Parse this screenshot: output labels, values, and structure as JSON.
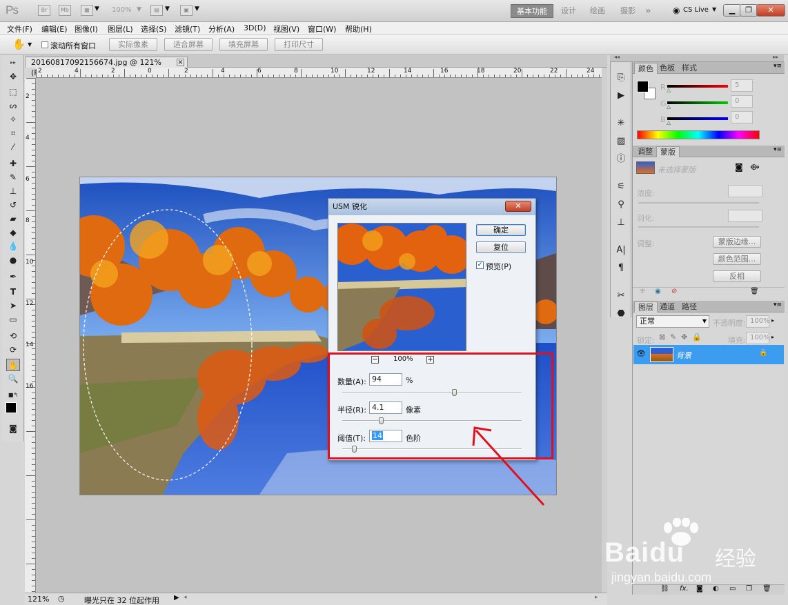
{
  "app": {
    "logo": "Ps",
    "zoom_level": "100%",
    "workspaces": [
      "基本功能",
      "设计",
      "绘画",
      "摄影"
    ],
    "more": "»",
    "cs_live": "CS Live"
  },
  "menu": [
    "文件(F)",
    "编辑(E)",
    "图像(I)",
    "图层(L)",
    "选择(S)",
    "滤镜(T)",
    "分析(A)",
    "3D(D)",
    "视图(V)",
    "窗口(W)",
    "帮助(H)"
  ],
  "options": {
    "scroll_all": "滚动所有窗口",
    "buttons": [
      "实际像素",
      "适合屏幕",
      "填充屏幕",
      "打印尺寸"
    ]
  },
  "document": {
    "tab_title": "20160817092156674.jpg @ 121%(RGB/8)",
    "ruler_top_ticks": [
      "2",
      "4",
      "2",
      "0",
      "2",
      "4",
      "6",
      "8",
      "10",
      "12",
      "14",
      "16",
      "18",
      "20",
      "22",
      "24"
    ],
    "ruler_left_ticks": [
      "2",
      "4",
      "6",
      "8",
      "10",
      "12",
      "14",
      "16"
    ],
    "status_zoom": "121%",
    "status_text": "曝光只在 32 位起作用"
  },
  "dialog": {
    "title": "USM 锐化",
    "ok": "确定",
    "reset": "复位",
    "preview_label": "预览(P)",
    "preview_checked": true,
    "zoom": "100%",
    "amount_label": "数量(A):",
    "amount_value": "94",
    "amount_unit": "%",
    "radius_label": "半径(R):",
    "radius_value": "4.1",
    "radius_unit": "像素",
    "threshold_label": "阈值(T):",
    "threshold_value": "14",
    "threshold_unit": "色阶"
  },
  "panels": {
    "color_tabs": [
      "颜色",
      "色板",
      "样式"
    ],
    "color_channels": [
      {
        "name": "R",
        "value": "5"
      },
      {
        "name": "G",
        "value": "0"
      },
      {
        "name": "B",
        "value": "0"
      }
    ],
    "adjust_tabs": [
      "调整",
      "蒙版"
    ],
    "no_mask": "未选择蒙版",
    "density_label": "浓度:",
    "feather_label": "羽化:",
    "refine_label": "调整:",
    "mask_edge_btn": "蒙版边缘...",
    "color_range_btn": "颜色范围...",
    "invert_btn": "反相",
    "layers_tabs": [
      "图层",
      "通道",
      "路径"
    ],
    "blend_mode": "正常",
    "opacity_label": "不透明度:",
    "opacity_value": "100%",
    "lock_label": "锁定:",
    "fill_label": "填充:",
    "fill_value": "100%",
    "layer_name": "背景"
  },
  "watermark": {
    "brand": "Bai",
    "brand2": "du",
    "cn": "经验",
    "url": "jingyan.baidu.com"
  },
  "colors": {
    "accent_red": "#e0101c",
    "layer_selected": "#3b9cf0"
  }
}
